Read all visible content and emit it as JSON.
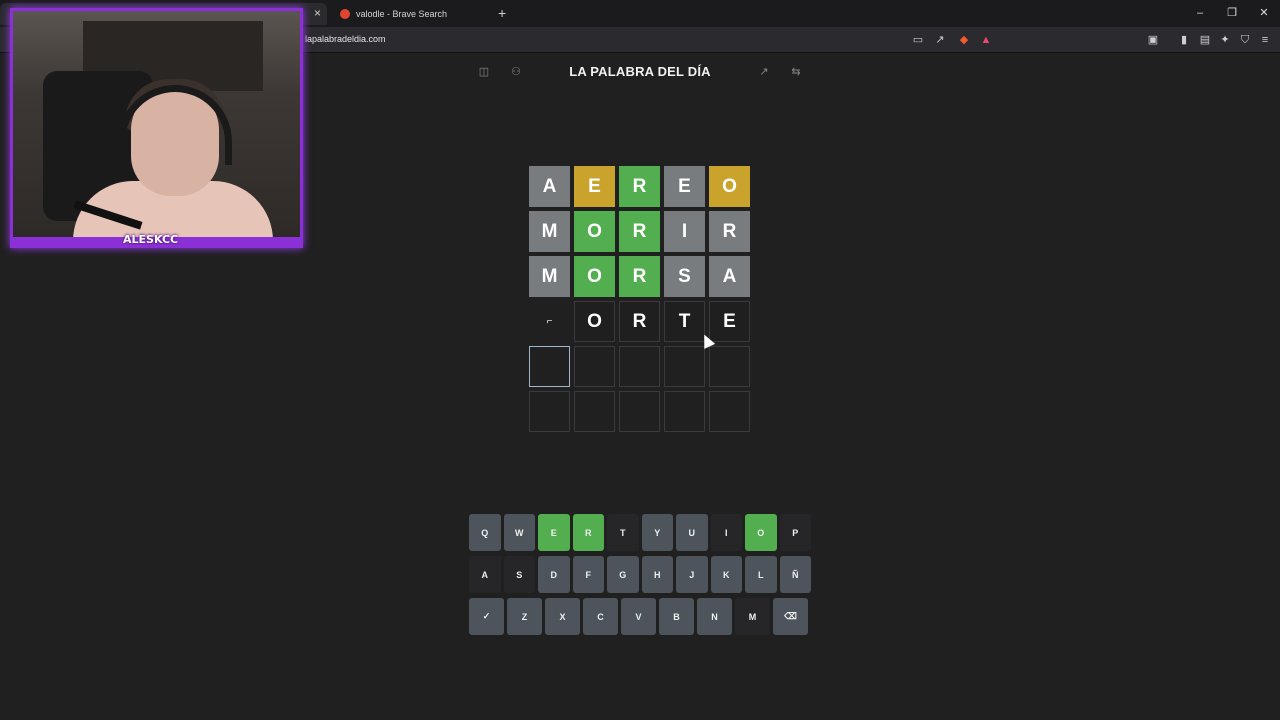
{
  "browser": {
    "tab_active_close": "×",
    "tab_2_title": "valodle - Brave Search",
    "new_tab": "+",
    "url": "lapalabradeldia.com",
    "window_controls": [
      "–",
      "❐",
      "✕"
    ]
  },
  "webcam": {
    "streamer_name": "ALESKCC"
  },
  "header": {
    "title": "LA PALABRA DEL DÍA"
  },
  "board": {
    "rows": [
      [
        {
          "l": "A",
          "s": "absent"
        },
        {
          "l": "E",
          "s": "present"
        },
        {
          "l": "R",
          "s": "correct"
        },
        {
          "l": "E",
          "s": "absent"
        },
        {
          "l": "O",
          "s": "present"
        }
      ],
      [
        {
          "l": "M",
          "s": "absent"
        },
        {
          "l": "O",
          "s": "correct"
        },
        {
          "l": "R",
          "s": "correct"
        },
        {
          "l": "I",
          "s": "absent"
        },
        {
          "l": "R",
          "s": "absent"
        }
      ],
      [
        {
          "l": "M",
          "s": "absent"
        },
        {
          "l": "O",
          "s": "correct"
        },
        {
          "l": "R",
          "s": "correct"
        },
        {
          "l": "S",
          "s": "absent"
        },
        {
          "l": "A",
          "s": "absent"
        }
      ],
      [
        {
          "l": "⌐",
          "s": "blank"
        },
        {
          "l": "O",
          "s": "typed"
        },
        {
          "l": "R",
          "s": "typed"
        },
        {
          "l": "T",
          "s": "typed"
        },
        {
          "l": "E",
          "s": "typed"
        }
      ],
      [
        {
          "l": "",
          "s": "active"
        },
        {
          "l": "",
          "s": "empty"
        },
        {
          "l": "",
          "s": "empty"
        },
        {
          "l": "",
          "s": "empty"
        },
        {
          "l": "",
          "s": "empty"
        }
      ],
      [
        {
          "l": "",
          "s": "empty"
        },
        {
          "l": "",
          "s": "empty"
        },
        {
          "l": "",
          "s": "empty"
        },
        {
          "l": "",
          "s": "empty"
        },
        {
          "l": "",
          "s": "empty"
        }
      ]
    ]
  },
  "keyboard": {
    "rows": [
      [
        {
          "k": "Q",
          "s": "default"
        },
        {
          "k": "W",
          "s": "default"
        },
        {
          "k": "E",
          "s": "correct"
        },
        {
          "k": "R",
          "s": "correct"
        },
        {
          "k": "T",
          "s": "absent"
        },
        {
          "k": "Y",
          "s": "default"
        },
        {
          "k": "U",
          "s": "default"
        },
        {
          "k": "I",
          "s": "absent"
        },
        {
          "k": "O",
          "s": "correct"
        },
        {
          "k": "P",
          "s": "absent"
        }
      ],
      [
        {
          "k": "A",
          "s": "absent"
        },
        {
          "k": "S",
          "s": "absent"
        },
        {
          "k": "D",
          "s": "default"
        },
        {
          "k": "F",
          "s": "default"
        },
        {
          "k": "G",
          "s": "default"
        },
        {
          "k": "H",
          "s": "default"
        },
        {
          "k": "J",
          "s": "default"
        },
        {
          "k": "K",
          "s": "default"
        },
        {
          "k": "L",
          "s": "default"
        },
        {
          "k": "Ñ",
          "s": "default"
        }
      ],
      [
        {
          "k": "✓",
          "s": "default"
        },
        {
          "k": "Z",
          "s": "default"
        },
        {
          "k": "X",
          "s": "default"
        },
        {
          "k": "C",
          "s": "default"
        },
        {
          "k": "V",
          "s": "default"
        },
        {
          "k": "B",
          "s": "default"
        },
        {
          "k": "N",
          "s": "default"
        },
        {
          "k": "M",
          "s": "absent"
        },
        {
          "k": "⌫",
          "s": "default"
        }
      ]
    ]
  },
  "colors": {
    "correct": "#52ae4f",
    "present": "#c9a32c",
    "absent_tile": "#787c7e",
    "key_default": "#4e545c",
    "key_absent": "#262628",
    "webcam_border": "#8b2fd6"
  },
  "icons": {
    "header_left": [
      "sidebar-toggle-icon",
      "user-icon"
    ],
    "header_right": [
      "stats-icon",
      "swap-icon"
    ],
    "toolbar": [
      "cast-icon",
      "share-icon",
      "brave-shield-icon",
      "brave-rewards-icon",
      "tabs-icon",
      "sidebar-icon",
      "wallet-icon",
      "leo-ai-icon",
      "vpn-icon",
      "menu-icon"
    ]
  }
}
